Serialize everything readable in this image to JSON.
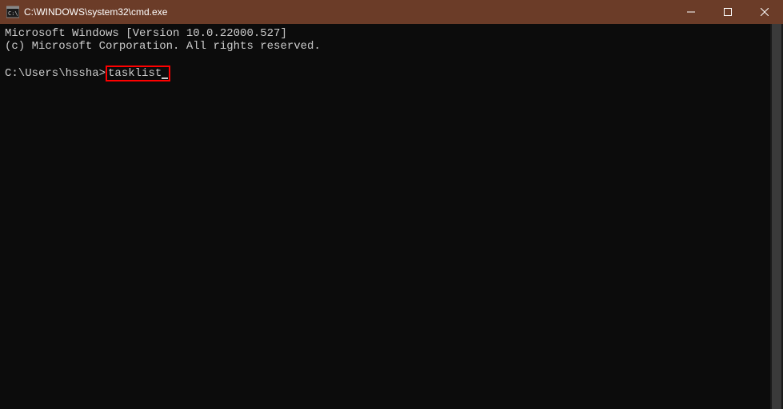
{
  "window": {
    "title": "C:\\WINDOWS\\system32\\cmd.exe"
  },
  "terminal": {
    "line1": "Microsoft Windows [Version 10.0.22000.527]",
    "line2": "(c) Microsoft Corporation. All rights reserved.",
    "prompt": "C:\\Users\\hssha>",
    "command": "tasklist"
  }
}
